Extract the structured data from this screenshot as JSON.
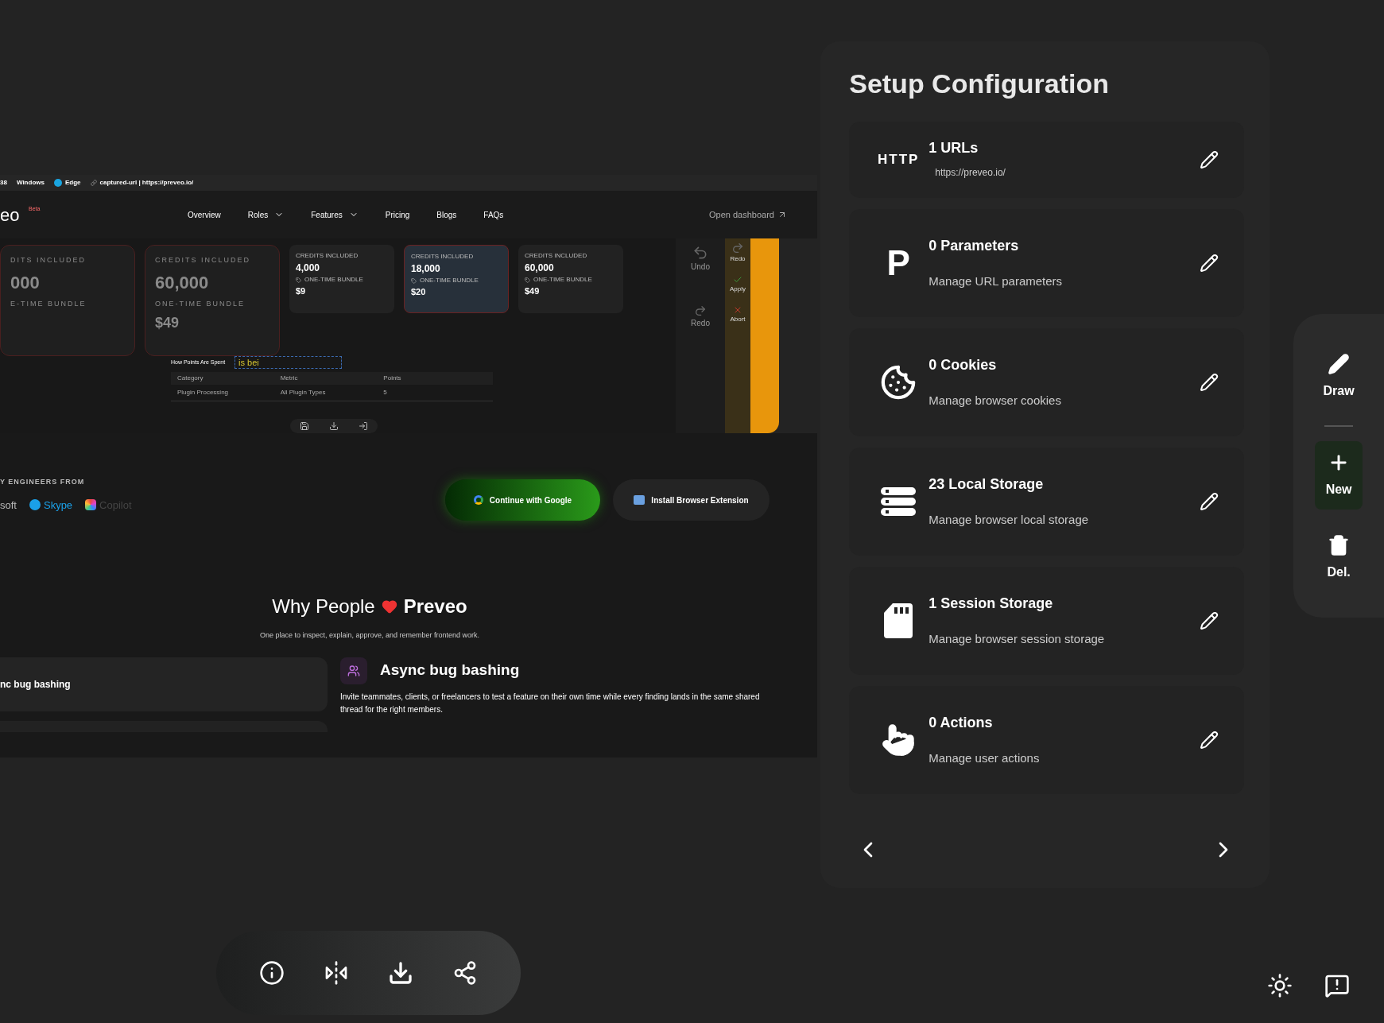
{
  "capture": {
    "info_bar": [
      {
        "kind": "text",
        "label": "38"
      },
      {
        "kind": "os",
        "label": "Windows"
      },
      {
        "kind": "browser",
        "label": "Edge"
      },
      {
        "kind": "link",
        "label": "captured-url | https://preveo.io/"
      }
    ],
    "nav": {
      "logo": "eo",
      "badge": "Beta",
      "links": [
        {
          "label": "Overview",
          "dropdown": false
        },
        {
          "label": "Roles",
          "dropdown": true
        },
        {
          "label": "Features",
          "dropdown": true
        },
        {
          "label": "Pricing",
          "dropdown": false
        },
        {
          "label": "Blogs",
          "dropdown": false
        },
        {
          "label": "FAQs",
          "dropdown": false
        }
      ],
      "dashboard": "Open dashboard"
    },
    "ghost_cards": [
      {
        "credits_label": "DITS INCLUDED",
        "credits": "000",
        "bundle": "E-TIME BUNDLE"
      },
      {
        "credits_label": "CREDITS INCLUDED",
        "credits": "60,000",
        "bundle": "ONE-TIME BUNDLE",
        "price": "$49"
      }
    ],
    "price_cards": [
      {
        "credits_label": "CREDITS INCLUDED",
        "credits": "4,000",
        "bundle": "ONE-TIME BUNDLE",
        "price": "$9",
        "selected": false
      },
      {
        "credits_label": "CREDITS INCLUDED",
        "credits": "18,000",
        "bundle": "ONE-TIME BUNDLE",
        "price": "$20",
        "selected": true
      },
      {
        "credits_label": "CREDITS INCLUDED",
        "credits": "60,000",
        "bundle": "ONE-TIME BUNDLE",
        "price": "$49",
        "selected": false
      }
    ],
    "points_title": "How Points Are Spent",
    "points_input": "is bei",
    "points_columns": [
      "Category",
      "Metric",
      "Points"
    ],
    "points_row": [
      "Plugin Processing",
      "All Plugin Types",
      "5"
    ],
    "edit_tools": [
      {
        "kind": "undo",
        "label": "Undo"
      },
      {
        "kind": "redo",
        "label": "Redo"
      }
    ],
    "edit_strip": [
      {
        "kind": "redo",
        "label": "Redo"
      },
      {
        "kind": "apply",
        "label": "Apply"
      },
      {
        "kind": "abort",
        "label": "Abort"
      }
    ],
    "engineers_label": "Y ENGINEERS FROM",
    "logos": [
      {
        "kind": "plain",
        "label": "soft"
      },
      {
        "kind": "skype",
        "label": "Skype"
      },
      {
        "kind": "copilot",
        "label": "Copilot"
      }
    ],
    "buttons": [
      {
        "kind": "google",
        "label": "Continue with Google"
      },
      {
        "kind": "extension",
        "label": "Install Browser Extension"
      }
    ],
    "heading_start": "Why People",
    "heading_end": "Preveo",
    "subtitle": "One place to inspect, explain, approve, and remember frontend work.",
    "tab_label": "nc bug bashing",
    "feature_title": "Async bug bashing",
    "feature_text": "Invite teammates, clients, or freelancers to test a feature on their own time while every finding lands in the same shared thread for the right members."
  },
  "panel": {
    "title": "Setup Configuration",
    "items": [
      {
        "kind": "http",
        "icon_text": "HTTP",
        "title": "1 URLs",
        "subtitle": "https://preveo.io/"
      },
      {
        "kind": "param",
        "icon_text": "P",
        "title": "0 Parameters",
        "subtitle": "Manage URL parameters"
      },
      {
        "kind": "cookies",
        "title": "0 Cookies",
        "subtitle": "Manage browser cookies"
      },
      {
        "kind": "local",
        "title": "23 Local Storage",
        "subtitle": "Manage browser local storage"
      },
      {
        "kind": "session",
        "title": "1 Session Storage",
        "subtitle": "Manage browser session storage"
      },
      {
        "kind": "actions",
        "title": "0 Actions",
        "subtitle": "Manage user actions"
      }
    ]
  },
  "side_tools": [
    {
      "kind": "draw",
      "label": "Draw",
      "selected": false
    },
    {
      "kind": "new",
      "label": "New",
      "selected": true
    },
    {
      "kind": "delete",
      "label": "Del.",
      "selected": false
    }
  ],
  "bottom_toolbar": [
    {
      "kind": "info"
    },
    {
      "kind": "compare"
    },
    {
      "kind": "download"
    },
    {
      "kind": "share"
    }
  ],
  "corner_tools": [
    {
      "kind": "theme"
    },
    {
      "kind": "feedback"
    }
  ]
}
